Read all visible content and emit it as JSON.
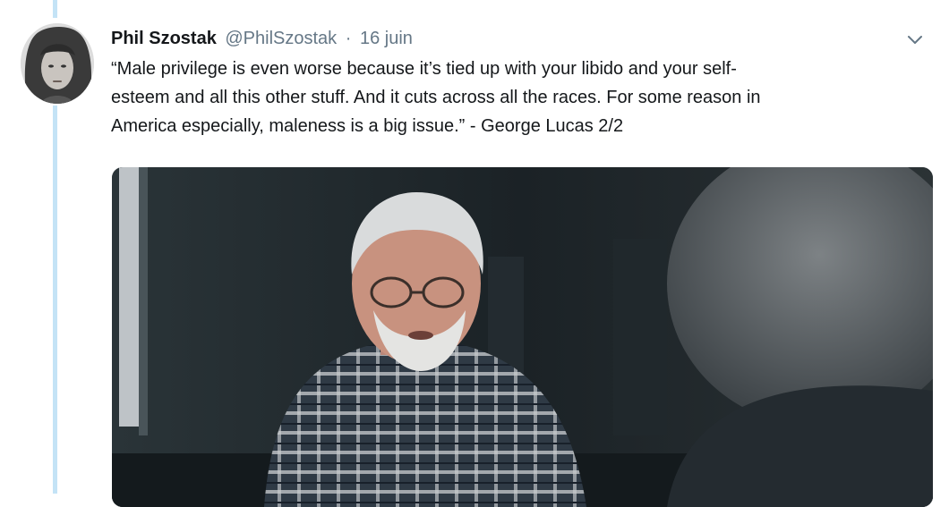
{
  "tweet": {
    "author_name": "Phil Szostak",
    "author_handle": "@PhilSzostak",
    "separator": "·",
    "timestamp": "16 juin",
    "text_lines": [
      "“Male privilege is even worse because it’s tied up with your libido and your self-",
      "esteem and all this other stuff. And it cuts across all the races. For some reason in",
      "America especially, maleness is a big issue.” - George Lucas 2/2"
    ]
  },
  "icons": {
    "menu": "chevron-down-icon",
    "avatar": "avatar",
    "media": "photo-image"
  },
  "colors": {
    "thread_line": "#c4e3f6",
    "secondary_text": "#657786",
    "primary_text": "#14171a",
    "background": "#ffffff"
  }
}
